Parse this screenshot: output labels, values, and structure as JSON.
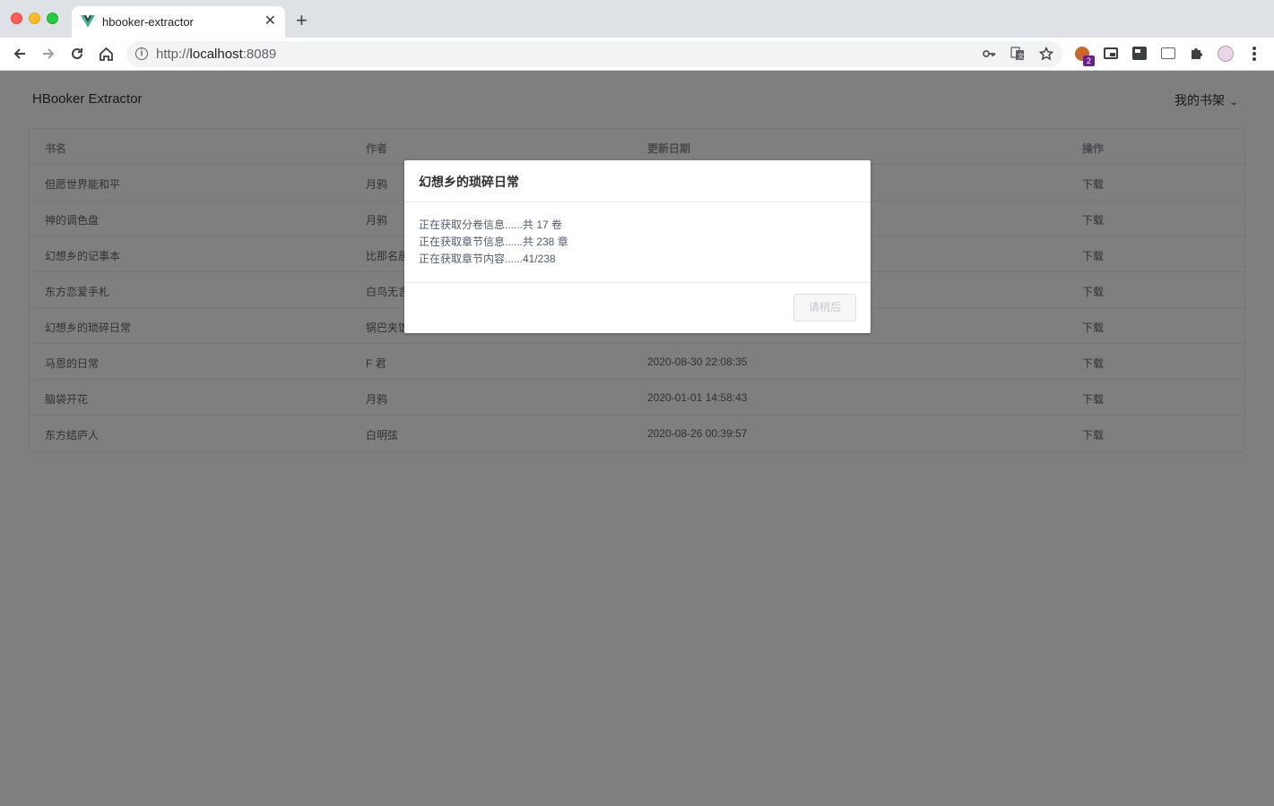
{
  "browser": {
    "tab_title": "hbooker-extractor",
    "url_host": "localhost",
    "url_prefix": "http://",
    "url_port": ":8089",
    "extension_badge": "2"
  },
  "header": {
    "title": "HBooker Extractor",
    "shelf_menu_label": "我的书架"
  },
  "table": {
    "columns": [
      "书名",
      "作者",
      "更新日期",
      "操作"
    ],
    "rows": [
      {
        "name": "但愿世界能和平",
        "author": "月鸦",
        "date": "",
        "action": "下载"
      },
      {
        "name": "神的调色盘",
        "author": "月鸦",
        "date": "",
        "action": "下载"
      },
      {
        "name": "幻想乡的记事本",
        "author": "比那名居",
        "date": "",
        "action": "下载"
      },
      {
        "name": "东方恋爱手札",
        "author": "白鸟无言",
        "date": "",
        "action": "下载"
      },
      {
        "name": "幻想乡的琐碎日常",
        "author": "锅巴夹饭",
        "date": "",
        "action": "下载"
      },
      {
        "name": "马恩的日常",
        "author": "F 君",
        "date": "2020-08-30 22:08:35",
        "action": "下载"
      },
      {
        "name": "脑袋开花",
        "author": "月鸦",
        "date": "2020-01-01 14:58:43",
        "action": "下载"
      },
      {
        "name": "东方结庐人",
        "author": "白明弦",
        "date": "2020-08-26 00:39:57",
        "action": "下载"
      }
    ]
  },
  "dialog": {
    "title": "幻想乡的琐碎日常",
    "lines": [
      "正在获取分卷信息......共 17 卷",
      "正在获取章节信息......共 238 章",
      "正在获取章节内容......41/238"
    ],
    "button_label": "请稍后"
  }
}
